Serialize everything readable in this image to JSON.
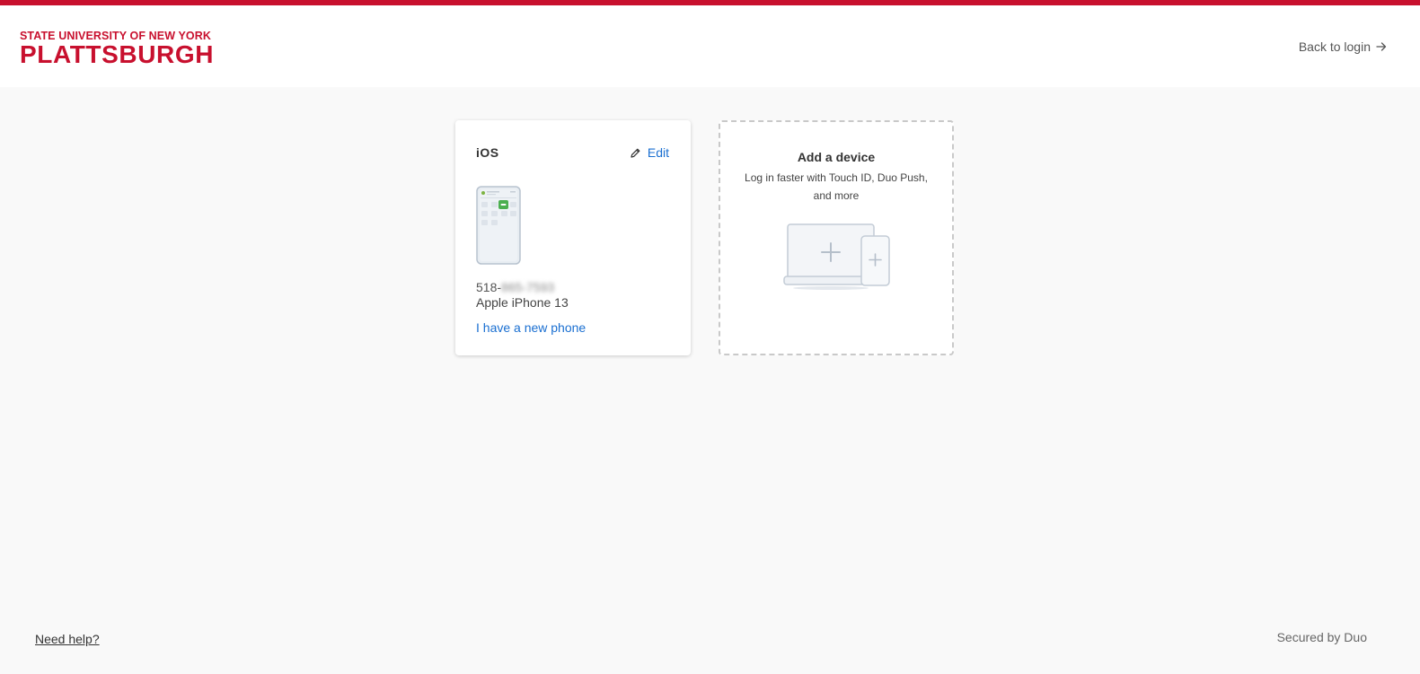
{
  "colors": {
    "brand_red": "#c8102e",
    "link_blue": "#1a6fd1",
    "page_bg": "#f9f9f9",
    "phone_badge_green": "#4caf50"
  },
  "header": {
    "logo_top": "STATE UNIVERSITY OF NEW YORK",
    "logo_main": "PLATTSBURGH",
    "back_link": "Back to login",
    "back_icon": "arrow-right-icon"
  },
  "device_card": {
    "title": "iOS",
    "edit_label": "Edit",
    "edit_icon": "pencil-icon",
    "phone_prefix": "518-",
    "phone_hidden": "865-7593",
    "model": "Apple iPhone 13",
    "new_phone_link": "I have a new phone"
  },
  "add_device_card": {
    "title": "Add a device",
    "description": "Log in faster with Touch ID, Duo Push, and more"
  },
  "footer": {
    "help_link": "Need help?",
    "secured_text": "Secured by Duo"
  }
}
